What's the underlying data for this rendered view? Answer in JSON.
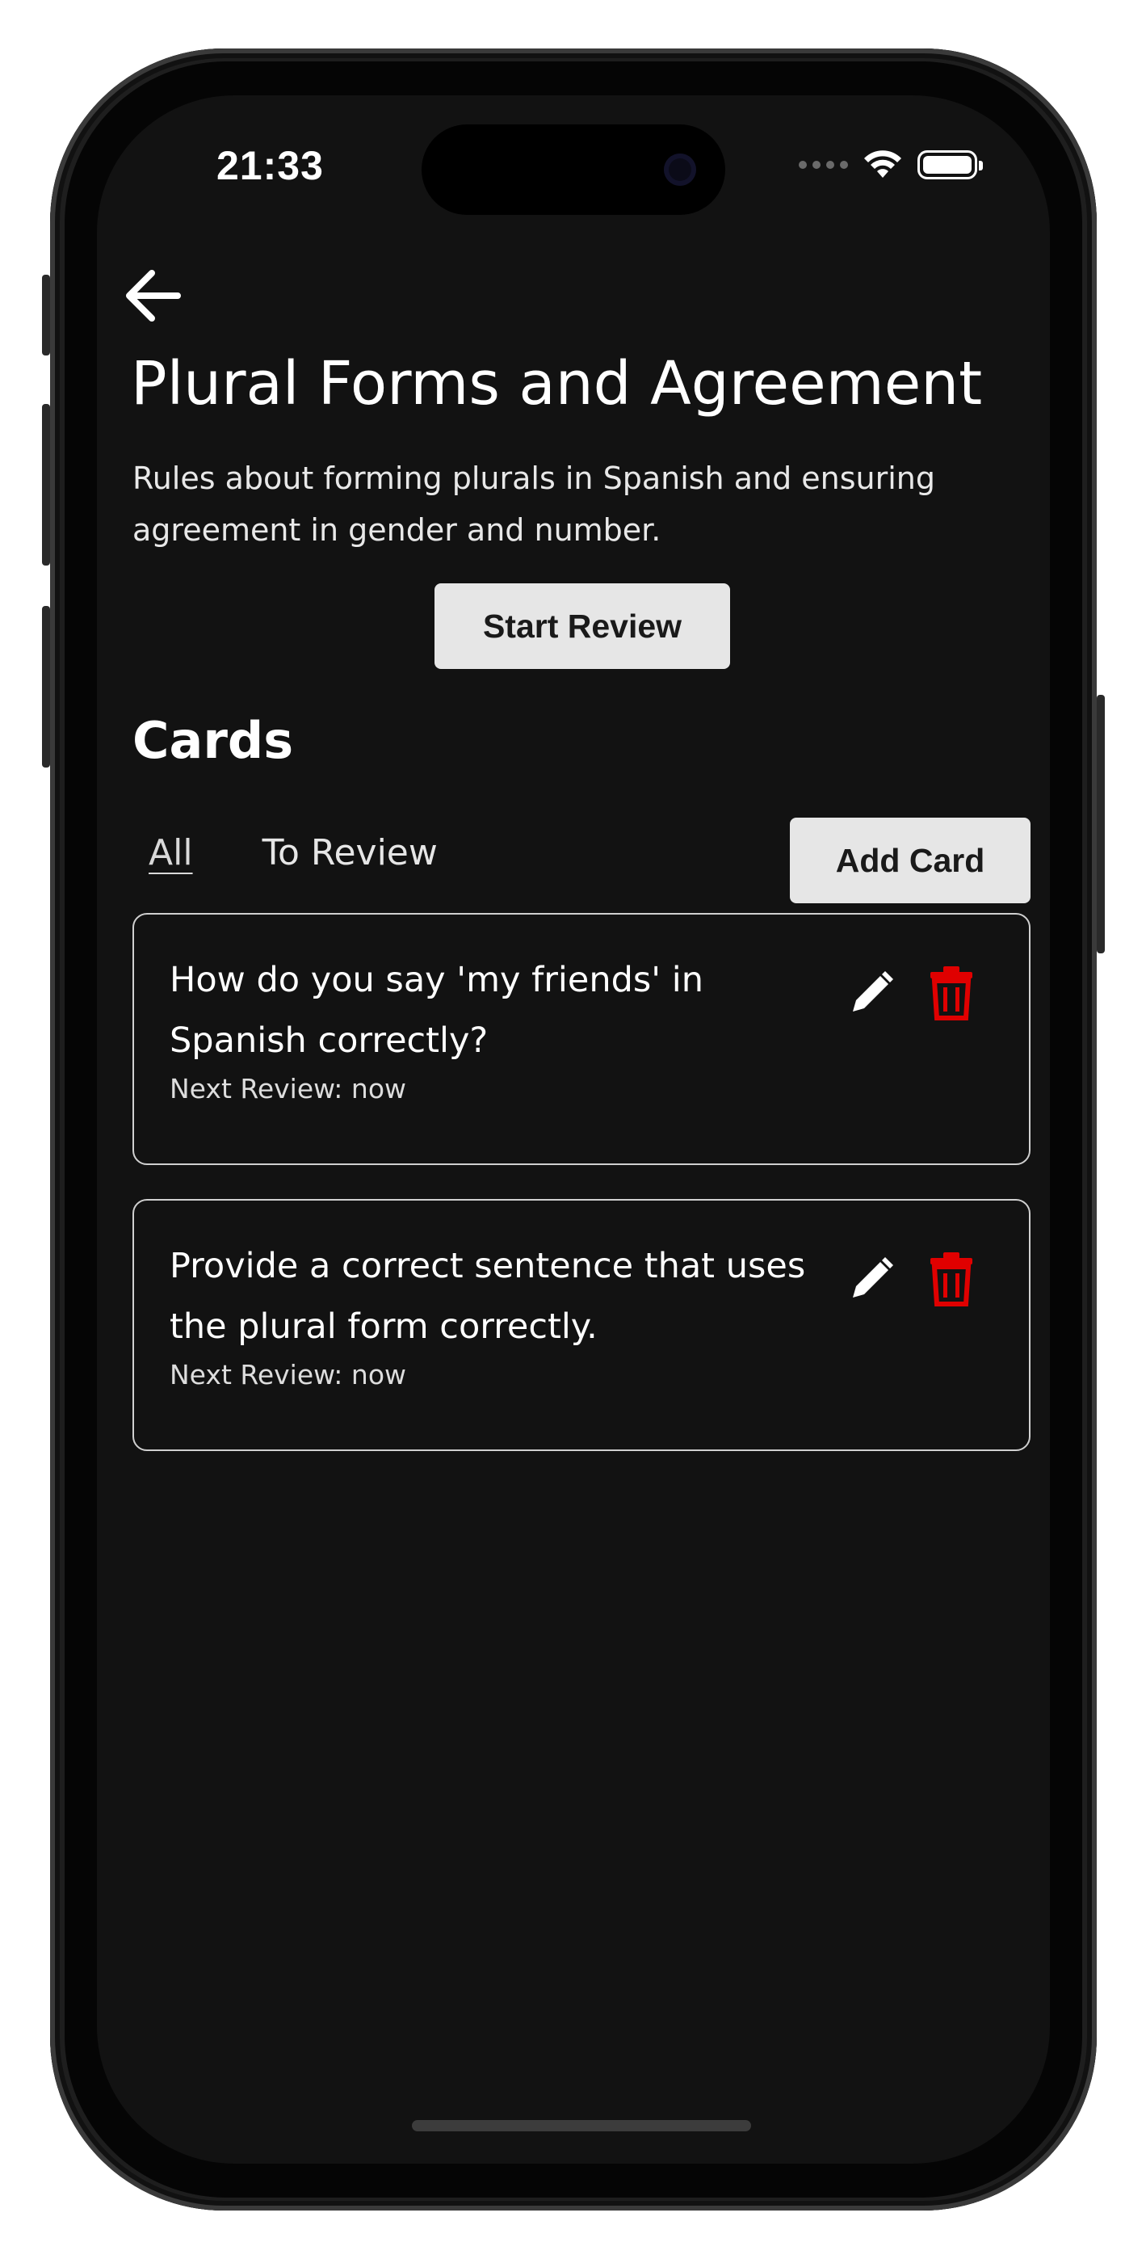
{
  "status_bar": {
    "time": "21:33"
  },
  "header": {
    "back_icon": "arrow-left-icon",
    "title": "Plural Forms and Agreement",
    "description": "Rules about forming plurals in Spanish and ensuring agreement in gender and number.",
    "start_review_label": "Start Review"
  },
  "cards_section": {
    "title": "Cards",
    "tabs": [
      {
        "label": "All",
        "active": true
      },
      {
        "label": "To Review",
        "active": false
      }
    ],
    "add_card_label": "Add Card",
    "cards": [
      {
        "question": "How do you say 'my friends' in Spanish correctly?",
        "next_review": "Next Review: now"
      },
      {
        "question": "Provide a correct sentence that uses the plural form correctly.",
        "next_review": "Next Review: now"
      }
    ]
  },
  "colors": {
    "background": "#121212",
    "button_bg": "#e6e6e6",
    "delete_icon": "#e00000",
    "text": "#ffffff"
  }
}
